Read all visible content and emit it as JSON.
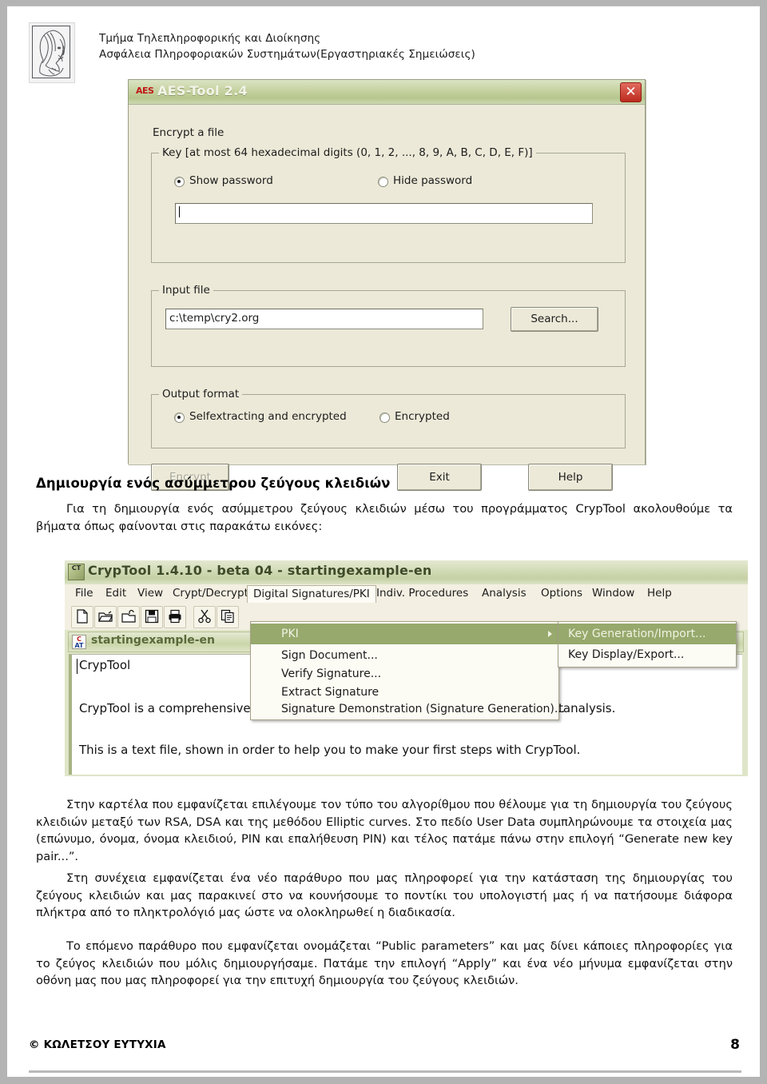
{
  "header": {
    "line1": "Τμήμα Τηλεπληροφορικής και Διοίκησης",
    "line2": "Ασφάλεια Πληροφοριακών Συστημάτων(Εργαστηριακές Σημειώσεις)",
    "crest_alt": "crest-logo"
  },
  "aes_tool": {
    "title": "AES-Tool 2.4",
    "icon_label": "AES",
    "close_label": "✕",
    "encrypt_a_file": "Encrypt a file",
    "key_group_legend": "Key [at most 64 hexadecimal digits (0, 1, 2, ..., 8, 9, A, B, C, D, E, F)]",
    "show_password": "Show password",
    "hide_password": "Hide password",
    "key_value": "",
    "input_file_legend": "Input file",
    "input_file_value": "c:\\temp\\cry2.org",
    "search_button": "Search...",
    "output_format_legend": "Output format",
    "output_selfextracting": "Selfextracting and encrypted",
    "output_encrypted": "Encrypted",
    "encrypt_button": "Encrypt",
    "exit_button": "Exit",
    "help_button": "Help"
  },
  "section": {
    "heading": "Δημιουργία ενός ασύμμετρου ζεύγους κλειδιών",
    "intro": "Για τη δημιουργία ενός ασύμμετρου ζεύγους κλειδιών μέσω του προγράμματος CrypTool ακολουθούμε τα βήματα όπως φαίνονται στις παρακάτω εικόνες:"
  },
  "cryptool": {
    "title": "CrypTool 1.4.10 - beta 04 - startingexample-en",
    "app_icon_label": "CT",
    "menubar": [
      "File",
      "Edit",
      "View",
      "Crypt/Decrypt",
      "Digital Signatures/PKI",
      "Indiv. Procedures",
      "Analysis",
      "Options",
      "Window",
      "Help"
    ],
    "active_menu": "Digital Signatures/PKI",
    "toolbar_icons": [
      "new-file-icon",
      "open-folder-icon",
      "open-unlocked-icon",
      "save-icon",
      "print-icon",
      "cut-icon",
      "copy-icon"
    ],
    "dropdown": [
      {
        "label": "PKI",
        "highlighted": true,
        "has_submenu": true
      },
      {
        "label": "Sign Document...",
        "highlighted": false,
        "has_submenu": false
      },
      {
        "label": "Verify Signature...",
        "highlighted": false,
        "has_submenu": false
      },
      {
        "label": "Extract Signature",
        "highlighted": false,
        "has_submenu": false
      },
      {
        "label": "Signature Demonstration (Signature Generation)...",
        "highlighted": false,
        "has_submenu": false
      }
    ],
    "submenu": [
      {
        "label": "Key Generation/Import...",
        "highlighted": true
      },
      {
        "label": "Key Display/Export...",
        "highlighted": false
      }
    ],
    "child_window_title": "startingexample-en",
    "document_lines": [
      "CrypTool",
      "CrypTool is a comprehensive educational program about cryptography and cryptanalysis.",
      "This is a text file, shown in order to help you to make your first steps with CrypTool."
    ]
  },
  "body_paragraphs": {
    "p1": "Στην καρτέλα που εμφανίζεται επιλέγουμε τον τύπο του αλγορίθμου που θέλουμε για τη δημιουργία του ζεύγους κλειδιών μεταξύ των RSA, DSA και της μεθόδου Elliptic curves. Στο πεδίο User Data συμπληρώνουμε τα στοιχεία μας (επώνυμο, όνομα, όνομα κλειδιού, PIN και επαλήθευση PIN) και τέλος πατάμε πάνω στην επιλογή “Generate new key pair...”.",
    "p2": "Στη συνέχεια εμφανίζεται ένα νέο παράθυρο που μας πληροφορεί για την κατάσταση της δημιουργίας του ζεύγους κλειδιών και μας παρακινεί στο να κουνήσουμε το ποντίκι του υπολογιστή μας ή να πατήσουμε διάφορα πλήκτρα από το πληκτρολόγιό μας ώστε να ολοκληρωθεί η διαδικασία.",
    "p3": "Το επόμενο παράθυρο που εμφανίζεται ονομάζεται “Public parameters” και μας δίνει κάποιες πληροφορίες για το ζεύγος κλειδιών που μόλις δημιουργήσαμε. Πατάμε την επιλογή “Apply” και ένα νέο μήνυμα εμφανίζεται στην οθόνη μας που μας πληροφορεί για την επιτυχή δημιουργία του ζεύγους κλειδιών."
  },
  "footer": {
    "copyright": "© ΚΩΛΕΤΣΟΥ ΕΥΤΥΧΙΑ",
    "page_number": "8"
  },
  "colors": {
    "frame": "#b4b4b4",
    "aes_title_green": "#b6c68d",
    "cryptool_menu_highlight": "#97a96c",
    "close_red": "#bc2a1e"
  }
}
